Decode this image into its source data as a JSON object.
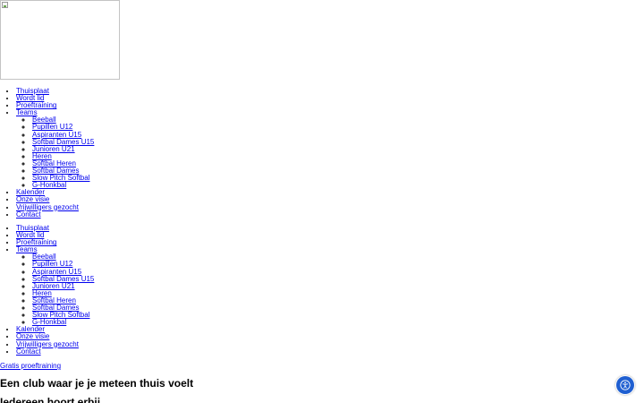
{
  "menu_primary": {
    "items": [
      {
        "label": "Thuisplaat"
      },
      {
        "label": "Wordt lid"
      },
      {
        "label": "Proeftraining"
      },
      {
        "label": "Teams"
      },
      {
        "label": "Kalender"
      },
      {
        "label": "Onze visie"
      },
      {
        "label": "Vrijwilligers gezocht"
      },
      {
        "label": "Contact"
      }
    ],
    "teams": [
      "Beeball",
      "Pupillen U12",
      "Aspiranten U15",
      "Softbal Dames U15",
      "Junioren U21",
      "Heren",
      "Softbal Heren",
      "Softbal Dames",
      "Slow Pitch Softbal",
      "G-Honkbal"
    ]
  },
  "menu_secondary": {
    "items": [
      {
        "label": "Thuisplaat"
      },
      {
        "label": "Wordt lid"
      },
      {
        "label": "Proeftraining"
      },
      {
        "label": "Teams"
      },
      {
        "label": "Kalender"
      },
      {
        "label": "Onze visie"
      },
      {
        "label": "Vrijwilligers gezocht"
      },
      {
        "label": "Contact"
      }
    ],
    "teams": [
      "Beeball",
      "Pupillen U12",
      "Aspiranten U15",
      "Softbal Dames U15",
      "Junioren U21",
      "Heren",
      "Softbal Heren",
      "Softbal Dames",
      "Slow Pitch Softbal",
      "G-Honkbal"
    ]
  },
  "hero": {
    "cta_label": "Gratis proeftraining",
    "heading": "Een club waar je je meteen thuis voelt",
    "subheading": "Iedereen hoort erbij"
  },
  "icons": {
    "logo": "broken-image-icon",
    "accessibility": "accessibility-icon"
  },
  "colors": {
    "link": "#0000ee",
    "accessibility_button": "#1f5fd1"
  }
}
